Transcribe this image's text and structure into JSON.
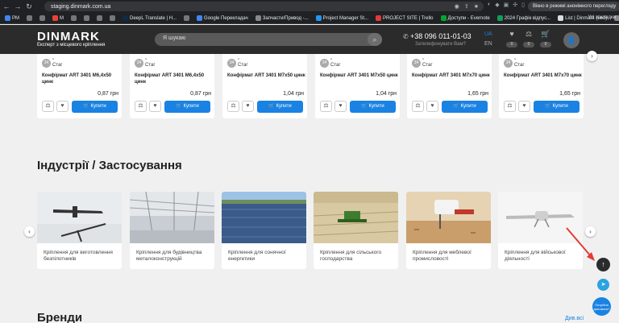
{
  "browser": {
    "url": "staging.dinmark.com.ua",
    "incognito_label": "Вікно в режимі анонімного перегляду",
    "bookmarks": [
      {
        "label": "PM",
        "color": "#4285f4"
      },
      {
        "label": "",
        "color": "#777"
      },
      {
        "label": "",
        "color": "#777"
      },
      {
        "label": "M",
        "color": "#ea4335"
      },
      {
        "label": "",
        "color": "#777"
      },
      {
        "label": "",
        "color": "#777"
      },
      {
        "label": "",
        "color": "#777"
      },
      {
        "label": "",
        "color": "#777"
      },
      {
        "label": "DeepL Translate | H...",
        "color": "#0f2b46"
      },
      {
        "label": "",
        "color": "#777"
      },
      {
        "label": "Google Перекладач",
        "color": "#4285f4"
      },
      {
        "label": "Запчасти/Привод -...",
        "color": "#888"
      },
      {
        "label": "Project Manager St...",
        "color": "#2196f3"
      },
      {
        "label": "PROJECT SITE | Trello",
        "color": "#e53935"
      },
      {
        "label": "Доступи - Evernote",
        "color": "#00a82d"
      },
      {
        "label": "2024 Графік відпус...",
        "color": "#0f9d58"
      },
      {
        "label": "List | Dinmark (Led)",
        "color": "#ddd"
      },
      {
        "label": "100 talk",
        "color": "#888"
      }
    ],
    "all_bookmarks": "Усі закладки"
  },
  "header": {
    "logo": "DINMARK",
    "tagline": "Експерт з місцевого кріплення",
    "search_placeholder": "Я шукаю",
    "phone": "+38 096 011-01-03",
    "callback": "Зателефонувати Вам?",
    "lang_active": "UA",
    "lang_other": "EN",
    "counts": [
      "0",
      "0",
      "0"
    ]
  },
  "products": [
    {
      "badge": "34",
      "brand": "Стаг",
      "name": "Конфірмат ART 3401 M6,4x50 цинк",
      "price": "0,87 грн",
      "buy": "Купити"
    },
    {
      "badge": "34",
      "brand": "Стаг",
      "name": "Конфірмат ART 3401 M6,4x50 цинк",
      "price": "0,87 грн",
      "buy": "Купити"
    },
    {
      "badge": "34",
      "brand": "Стаг",
      "name": "Конфірмат ART 3401 M7x50 цинк",
      "price": "1,04 грн",
      "buy": "Купити"
    },
    {
      "badge": "34",
      "brand": "Стаг",
      "name": "Конфірмат ART 3401 M7x50 цинк",
      "price": "1,04 грн",
      "buy": "Купити"
    },
    {
      "badge": "34",
      "brand": "Стаг",
      "name": "Конфірмат ART 3401 M7x70 цинк",
      "price": "1,65 грн",
      "buy": "Купити"
    },
    {
      "badge": "34",
      "brand": "Стаг",
      "name": "Конфірмат ART 3401 M7x70 цинк",
      "price": "1,65 грн",
      "buy": "Купити"
    }
  ],
  "industries": {
    "title": "Індустрії / Застосування",
    "items": [
      {
        "label": "Кріплення для виготовлення безпілотників"
      },
      {
        "label": "Кріплення для будівництва металоконструкцій"
      },
      {
        "label": "Кріплення для сонячної енергетики"
      },
      {
        "label": "Кріплення для сільського господарства"
      },
      {
        "label": "Кріплення для меблевої промисловості"
      },
      {
        "label": "Кріплення для військової діяльності"
      }
    ]
  },
  "floating": {
    "chat_label": "Потрібна допомога?"
  },
  "brands": {
    "title": "Бренди",
    "see_all": "Див.всі"
  },
  "colors": {
    "accent": "#1a82e2",
    "header_bg": "#2b2b2b",
    "arrow": "#e53935"
  }
}
